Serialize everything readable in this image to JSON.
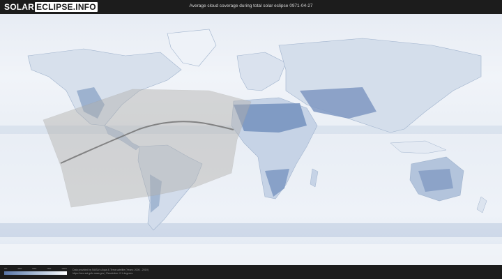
{
  "header": {
    "logo_left": "SOLAR",
    "logo_right": "ECLIPSE.INFO",
    "title": "Average cloud coverage during total solar eclipse 0971-04-27"
  },
  "legend": {
    "ticks": [
      "0%",
      "25%",
      "50%",
      "75%",
      "100%"
    ],
    "colors": [
      "#5a76a8",
      "#8ea6c8",
      "#c3d1e3",
      "#ffffff"
    ]
  },
  "footer": {
    "credit_line1": "Data provided by NASA's Aqua & Terra satellite (Years: 2000 - 2019)",
    "credit_line2": "https://neo.sci.gsfc.nasa.gov | Resolution: 0.1 degrees"
  },
  "colors": {
    "background": "#1c1c1c",
    "ocean_clouds": "#dfe6f0",
    "land_clear": "#7f98c2",
    "eclipse_band": "#b3b1ad",
    "eclipse_path": "#6e6e6e"
  }
}
